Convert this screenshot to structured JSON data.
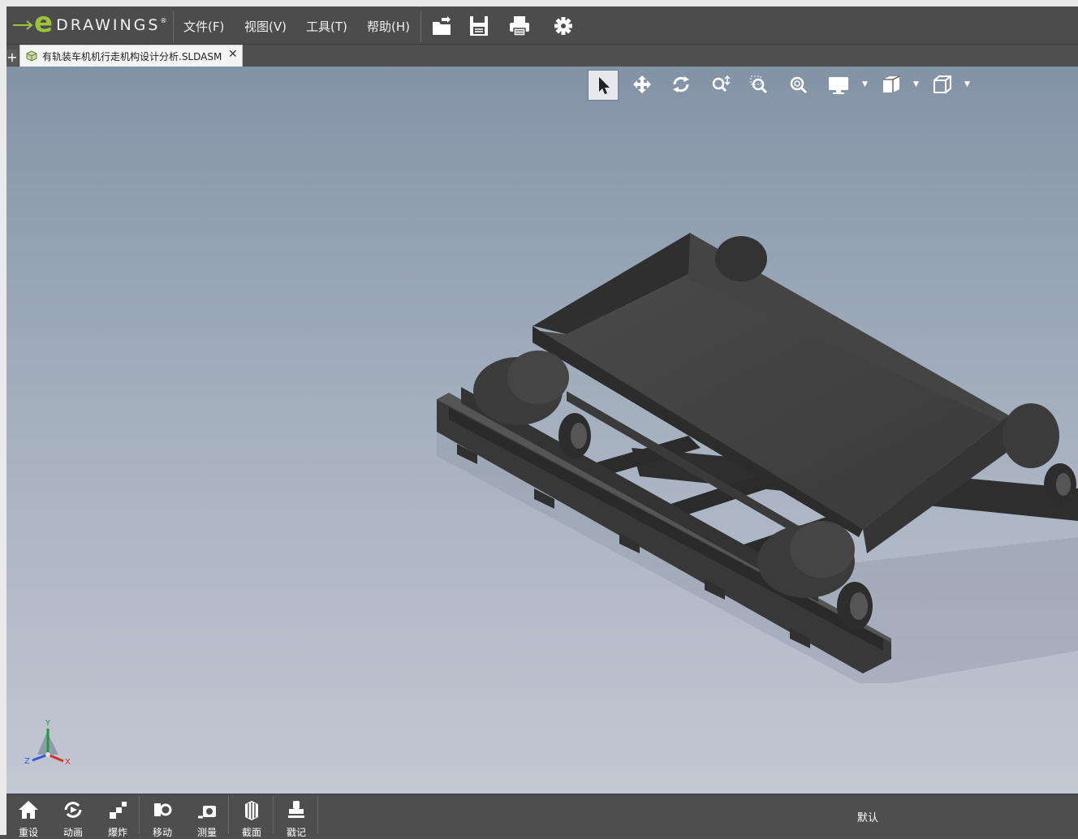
{
  "app": {
    "logo_word": "DRAWINGS",
    "logo_e": "e"
  },
  "menu": [
    "文件(F)",
    "视图(V)",
    "工具(T)",
    "帮助(H)"
  ],
  "toolbar_icons": [
    "open-icon",
    "save-icon",
    "print-icon",
    "settings-icon"
  ],
  "tab": {
    "add_label": "+",
    "file_name": "有轨装车机机行走机构设计分析.SLDASM",
    "close_label": "✕"
  },
  "view_tools": [
    "select-icon",
    "pan-icon",
    "rotate-icon",
    "zoom-icon",
    "zoom-area-icon",
    "zoom-fit-icon",
    "display-icon",
    "view-orientation-icon",
    "standard-views-icon"
  ],
  "triad": {
    "x": "X",
    "y": "Y",
    "z": "Z"
  },
  "bottom_tools": [
    {
      "label": "重设",
      "icon": "home-icon"
    },
    {
      "label": "动画",
      "icon": "animate-icon"
    },
    {
      "label": "爆炸",
      "icon": "explode-icon"
    },
    {
      "label": "移动",
      "icon": "move-icon"
    },
    {
      "label": "测量",
      "icon": "measure-icon"
    },
    {
      "label": "截面",
      "icon": "section-icon"
    },
    {
      "label": "戳记",
      "icon": "stamp-icon"
    }
  ],
  "configuration": "默认",
  "colors": {
    "accent": "#9cc33a",
    "chrome": "#4c4c4c",
    "viewport_top": "#8393a6",
    "viewport_bottom": "#c3c8d3",
    "model": "#3f3f3f"
  }
}
